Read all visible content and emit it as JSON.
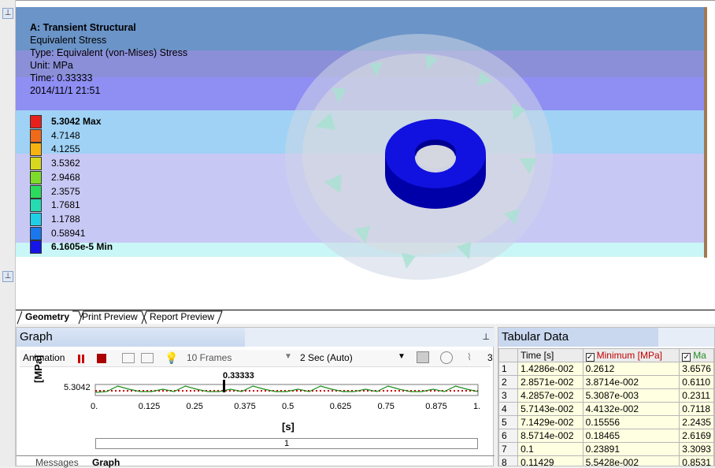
{
  "viewport": {
    "title": "A: Transient Structural",
    "lines": [
      "Equivalent Stress",
      "Type: Equivalent (von-Mises) Stress",
      "Unit: MPa",
      "Time: 0.33333",
      "2014/11/1 21:51"
    ],
    "legend": [
      {
        "label": "5.3042 Max",
        "color": "#e8201c",
        "bold": true
      },
      {
        "label": "4.7148",
        "color": "#f06a1a"
      },
      {
        "label": "4.1255",
        "color": "#f5b210"
      },
      {
        "label": "3.5362",
        "color": "#d7d81e"
      },
      {
        "label": "2.9468",
        "color": "#7edb2a"
      },
      {
        "label": "2.3575",
        "color": "#2bdc5c"
      },
      {
        "label": "1.7681",
        "color": "#26dbb1"
      },
      {
        "label": "1.1788",
        "color": "#1fcfe6"
      },
      {
        "label": "0.58941",
        "color": "#1a78ee"
      },
      {
        "label": "6.1605e-5 Min",
        "color": "#1515e8",
        "bold": true
      }
    ]
  },
  "view_tabs": [
    "Geometry",
    "Print Preview",
    "Report Preview"
  ],
  "graph": {
    "title": "Graph",
    "animation_label": "Animation",
    "frames": "10 Frames",
    "duration": "2 Sec (Auto)",
    "frame_count_partial": "3",
    "y_axis_label": "[MPa]",
    "y_tick": "5.3042",
    "marker_label": "0.33333",
    "x_ticks": [
      "0.",
      "0.125",
      "0.25",
      "0.375",
      "0.5",
      "0.625",
      "0.75",
      "0.875",
      "1."
    ],
    "x_axis_label": "[s]",
    "slider_value": "1",
    "bottom_tabs": [
      "Messages",
      "Graph"
    ]
  },
  "tabular": {
    "title": "Tabular Data",
    "headers": [
      "Time [s]",
      "Minimum [MPa]",
      "Ma"
    ],
    "header_colors": {
      "minimum": "#c00000",
      "maximum": "#228b22"
    },
    "rows": [
      [
        "1",
        "1.4286e-002",
        "0.2612",
        "3.6576"
      ],
      [
        "2",
        "2.8571e-002",
        "3.8714e-002",
        "0.6110"
      ],
      [
        "3",
        "4.2857e-002",
        "5.3087e-003",
        "0.2311"
      ],
      [
        "4",
        "5.7143e-002",
        "4.4132e-002",
        "0.7118"
      ],
      [
        "5",
        "7.1429e-002",
        "0.15556",
        "2.2435"
      ],
      [
        "6",
        "8.5714e-002",
        "0.18465",
        "2.6169"
      ],
      [
        "7",
        "0.1",
        "0.23891",
        "3.3093"
      ],
      [
        "8",
        "0.11429",
        "5.5428e-002",
        "0.8531"
      ]
    ]
  }
}
